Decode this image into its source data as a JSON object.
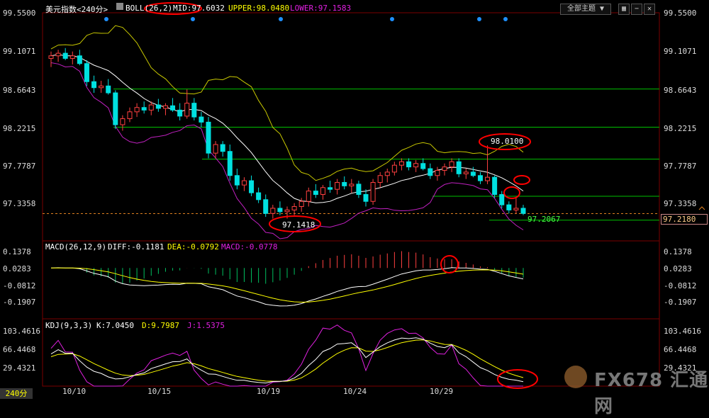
{
  "header": {
    "title": "美元指数<240分>",
    "boll": "BOLL(26,2)",
    "mid": "MID:97.6032",
    "upper": "UPPER:98.0480",
    "lower": "LOWER:97.1583",
    "dropdown": "全部主题",
    "dropdown_arrow": "▼"
  },
  "macd_header": {
    "name": "MACD(26,12,9)",
    "diff": "DIFF:-0.1181",
    "dea": "DEA:-0.0792",
    "macd": "MACD:-0.0778"
  },
  "kdj_header": {
    "name": "KDJ(9,3,3)",
    "k": "K:7.0450",
    "d": "D:9.7987",
    "j": "J:1.5375"
  },
  "price_axis": [
    "99.5500",
    "99.1071",
    "98.6643",
    "98.2215",
    "97.7787",
    "97.3358"
  ],
  "current_price": "97.2180",
  "macd_axis": [
    "0.1378",
    "0.0283",
    "-0.0812",
    "-0.1907"
  ],
  "kdj_axis": [
    "103.4616",
    "66.4468",
    "29.4321"
  ],
  "x_axis": [
    "10/10",
    "10/15",
    "10/19",
    "10/24",
    "10/29"
  ],
  "period": "240分",
  "annotations": {
    "high": "98.0100",
    "low": "97.1418",
    "last": "97.2067"
  },
  "watermark": "FX678 汇通网",
  "colors": {
    "up": "#ff4040",
    "down": "#00e0e0",
    "mid_line": "#ffffff",
    "upper_line": "#c8c800",
    "lower_line": "#c020c0",
    "level_line": "#00c000",
    "circle": "#ff0000",
    "dea_line": "#ffff00",
    "diff_line": "#ffffff",
    "macd_neg": "#00c060",
    "macd_pos": "#ff4040",
    "j_line": "#e020e0"
  },
  "chart_data": {
    "type": "candlestick",
    "title": "美元指数<240分>",
    "ylim": [
      97.0,
      99.55
    ],
    "levels": [
      98.6643,
      98.2215,
      97.85,
      97.42,
      97.1418
    ],
    "x_ticks": [
      "10/10",
      "10/15",
      "10/19",
      "10/24",
      "10/29"
    ],
    "candles": [
      [
        99.02,
        99.1,
        98.92,
        99.05
      ],
      [
        99.05,
        99.12,
        98.98,
        99.08
      ],
      [
        99.08,
        99.14,
        99.0,
        99.02
      ],
      [
        99.02,
        99.1,
        98.95,
        99.05
      ],
      [
        99.05,
        99.12,
        98.94,
        98.96
      ],
      [
        98.96,
        99.0,
        98.7,
        98.75
      ],
      [
        98.75,
        98.82,
        98.62,
        98.68
      ],
      [
        98.68,
        98.76,
        98.62,
        98.7
      ],
      [
        98.7,
        98.78,
        98.6,
        98.62
      ],
      [
        98.62,
        98.65,
        98.2,
        98.25
      ],
      [
        98.25,
        98.36,
        98.18,
        98.32
      ],
      [
        98.32,
        98.45,
        98.28,
        98.4
      ],
      [
        98.4,
        98.5,
        98.34,
        98.45
      ],
      [
        98.45,
        98.52,
        98.38,
        98.42
      ],
      [
        98.42,
        98.52,
        98.36,
        98.48
      ],
      [
        98.48,
        98.55,
        98.4,
        98.44
      ],
      [
        98.44,
        98.5,
        98.36,
        98.47
      ],
      [
        98.47,
        98.56,
        98.4,
        98.42
      ],
      [
        98.42,
        98.5,
        98.3,
        98.35
      ],
      [
        98.35,
        98.66,
        98.32,
        98.5
      ],
      [
        98.5,
        98.56,
        98.3,
        98.34
      ],
      [
        98.34,
        98.4,
        98.22,
        98.28
      ],
      [
        98.28,
        98.34,
        97.86,
        97.92
      ],
      [
        97.92,
        98.06,
        97.86,
        98.02
      ],
      [
        98.02,
        98.06,
        97.88,
        97.94
      ],
      [
        97.94,
        98.02,
        97.6,
        97.66
      ],
      [
        97.66,
        97.74,
        97.5,
        97.55
      ],
      [
        97.55,
        97.64,
        97.48,
        97.6
      ],
      [
        97.6,
        97.66,
        97.42,
        97.46
      ],
      [
        97.46,
        97.52,
        97.34,
        97.38
      ],
      [
        97.38,
        97.44,
        97.18,
        97.22
      ],
      [
        97.22,
        97.32,
        97.16,
        97.28
      ],
      [
        97.28,
        97.36,
        97.2,
        97.24
      ],
      [
        97.24,
        97.3,
        97.16,
        97.26
      ],
      [
        97.26,
        97.34,
        97.2,
        97.3
      ],
      [
        97.3,
        97.4,
        97.24,
        97.36
      ],
      [
        97.36,
        97.52,
        97.3,
        97.48
      ],
      [
        97.48,
        97.56,
        97.4,
        97.44
      ],
      [
        97.44,
        97.55,
        97.38,
        97.52
      ],
      [
        97.52,
        97.6,
        97.46,
        97.5
      ],
      [
        97.5,
        97.62,
        97.44,
        97.58
      ],
      [
        97.58,
        97.65,
        97.5,
        97.54
      ],
      [
        97.54,
        97.62,
        97.46,
        97.56
      ],
      [
        97.56,
        97.6,
        97.4,
        97.44
      ],
      [
        97.44,
        97.5,
        97.3,
        97.36
      ],
      [
        97.36,
        97.62,
        97.32,
        97.58
      ],
      [
        97.58,
        97.7,
        97.52,
        97.66
      ],
      [
        97.66,
        97.74,
        97.58,
        97.7
      ],
      [
        97.7,
        97.82,
        97.66,
        97.78
      ],
      [
        97.78,
        97.86,
        97.72,
        97.82
      ],
      [
        97.82,
        97.86,
        97.72,
        97.76
      ],
      [
        97.76,
        97.84,
        97.7,
        97.8
      ],
      [
        97.8,
        97.86,
        97.72,
        97.74
      ],
      [
        97.74,
        97.8,
        97.62,
        97.66
      ],
      [
        97.66,
        97.76,
        97.6,
        97.72
      ],
      [
        97.72,
        97.8,
        97.66,
        97.76
      ],
      [
        97.76,
        97.86,
        97.7,
        97.82
      ],
      [
        97.82,
        97.86,
        97.64,
        97.68
      ],
      [
        97.68,
        97.74,
        97.62,
        97.7
      ],
      [
        97.7,
        97.76,
        97.64,
        97.66
      ],
      [
        97.66,
        97.7,
        97.56,
        97.6
      ],
      [
        97.6,
        98.01,
        97.56,
        97.64
      ],
      [
        97.64,
        97.66,
        97.4,
        97.44
      ],
      [
        97.44,
        97.48,
        97.28,
        97.32
      ],
      [
        97.32,
        97.36,
        97.22,
        97.26
      ],
      [
        97.26,
        97.4,
        97.22,
        97.28
      ],
      [
        97.28,
        97.32,
        97.2,
        97.22
      ]
    ],
    "macd_ylim": [
      -0.3,
      0.16
    ],
    "kdj_ylim": [
      0,
      120
    ]
  }
}
